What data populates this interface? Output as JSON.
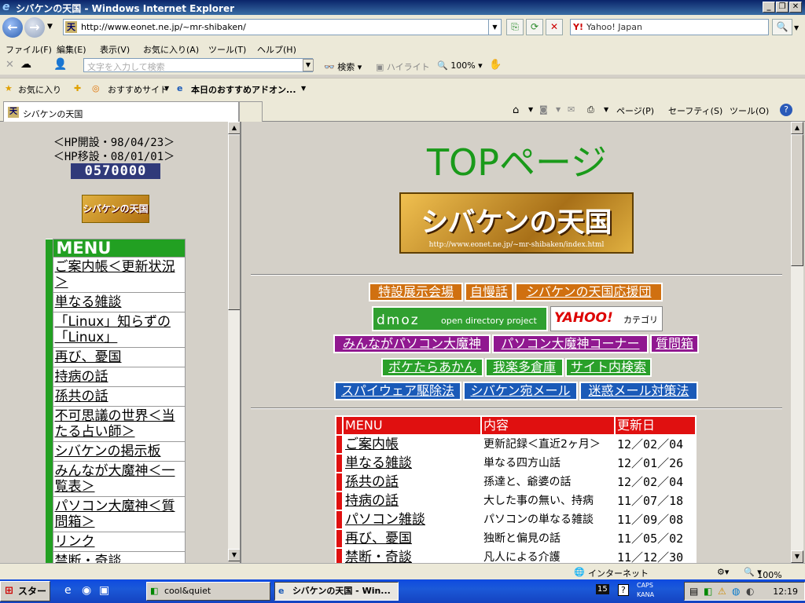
{
  "window": {
    "title": "シバケンの天国 - Windows Internet Explorer"
  },
  "address": {
    "url": "http://www.eonet.ne.jp/~mr-shibaken/",
    "search_value": "Yahoo! Japan"
  },
  "menu": {
    "items": [
      "ファイル(F)",
      "編集(E)",
      "表示(V)",
      "お気に入り(A)",
      "ツール(T)",
      "ヘルプ(H)"
    ]
  },
  "toolbar2": {
    "placeholder": "文字を入力して検索",
    "search": "検索",
    "highlight": "ハイライト",
    "zoom": "100%"
  },
  "links": {
    "favorites": "お気に入り",
    "recommended": "おすすめサイト",
    "addon": "本日のおすすめアドオン..."
  },
  "tab": {
    "title": "シバケンの天国"
  },
  "command_bar": {
    "page": "ページ(P)",
    "safety": "セーフティ(S)",
    "tools": "ツール(O)"
  },
  "left": {
    "opened": "＜HP開設・98/04/23＞",
    "moved": "＜HP移設・08/01/01＞",
    "counter": "0570000",
    "logo": "シバケンの天国",
    "menu_header": "MENU",
    "menu_items": [
      "ご案内帳＜更新状況＞",
      "単なる雑談",
      "「Linux」知らずの「Linux」",
      "再び、憂国",
      "持病の話",
      "孫共の話",
      "不可思議の世界＜当たる占い師＞",
      "シバケンの掲示板",
      "みんなが大魔神＜一覧表＞",
      "パソコン大魔神＜質問箱＞",
      "リンク",
      "禁断・奇談"
    ]
  },
  "main": {
    "title": "TOPページ",
    "banner": "シバケンの天国",
    "banner_url": "http://www.eonet.ne.jp/~mr-shibaken/index.html",
    "buttons_row1": [
      "特設展示会場",
      "自慢話",
      "シバケンの天国応援団"
    ],
    "dmoz": "dmoz",
    "dmoz_sub": "open directory project",
    "yahoo": "YAHOO!",
    "yahoo_sub": "カテゴリ",
    "buttons_row3": [
      "みんながパソコン大魔神",
      "パソコン大魔神コーナー",
      "質問箱"
    ],
    "buttons_row4": [
      "ボケたらあかん",
      "我楽多倉庫",
      "サイト内検索"
    ],
    "buttons_row5": [
      "スパイウェア駆除法",
      "シバケン宛メール",
      "迷惑メール対策法"
    ],
    "table_headers": [
      "MENU",
      "内容",
      "更新日"
    ],
    "table_rows": [
      {
        "menu": "ご案内帳",
        "content": "更新記録＜直近2ヶ月＞",
        "date": "12／02／04"
      },
      {
        "menu": "単なる雑談",
        "content": "単なる四方山話",
        "date": "12／01／26"
      },
      {
        "menu": "孫共の話",
        "content": "孫達と、爺婆の話",
        "date": "12／02／04"
      },
      {
        "menu": "持病の話",
        "content": "大した事の無い、持病",
        "date": "11／07／18"
      },
      {
        "menu": "パソコン雑談",
        "content": "パソコンの単なる雑談",
        "date": "11／09／08"
      },
      {
        "menu": "再び、憂国",
        "content": "独断と偏見の話",
        "date": "11／05／02"
      },
      {
        "menu": "禁断・奇談",
        "content": "凡人による介護",
        "date": "11／12／30"
      }
    ]
  },
  "status": {
    "zone": "インターネット",
    "zoom": "100%"
  },
  "taskbar": {
    "start": "スタート",
    "task1": "cool&quiet",
    "task2": "シバケンの天国 - Win...",
    "caps": "CAPS",
    "kana": "KANA",
    "clock": "12:19"
  }
}
